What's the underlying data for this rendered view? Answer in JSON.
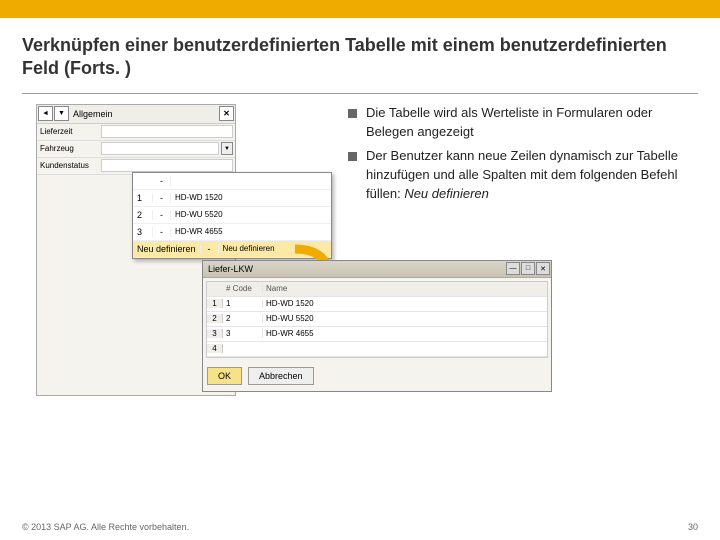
{
  "slide": {
    "title": "Verknüpfen einer benutzerdefinierten Tabelle mit einem benutzerdefinierten Feld (Forts. )",
    "footer_left": "© 2013 SAP AG. Alle Rechte vorbehalten.",
    "footer_right": "30"
  },
  "bullets": [
    "Die Tabelle wird als Werteliste in Formularen oder Belegen angezeigt",
    "Der Benutzer kann neue Zeilen dynamisch zur Tabelle hinzufügen und alle Spalten mit dem folgenden Befehl füllen: "
  ],
  "bullet2_italic": "Neu definieren",
  "shot1": {
    "header": "Allgemein",
    "row1": "Lieferzeit",
    "row2": "Fahrzeug",
    "row3": "Kundenstatus"
  },
  "dropdown": {
    "rows": [
      {
        "n": "",
        "mid": "-",
        "val": ""
      },
      {
        "n": "1",
        "mid": "-",
        "val": "HD-WD 1520"
      },
      {
        "n": "2",
        "mid": "-",
        "val": "HD-WU 5520"
      },
      {
        "n": "3",
        "mid": "-",
        "val": "HD-WR 4655"
      },
      {
        "n": "Neu definieren",
        "mid": "-",
        "val": "Neu definieren"
      }
    ]
  },
  "shot2": {
    "title": "Liefer-LKW",
    "header_code": "# Code",
    "header_name": "Name",
    "rows": [
      {
        "n": "1",
        "code": "1",
        "name": "HD-WD 1520"
      },
      {
        "n": "2",
        "code": "2",
        "name": "HD-WU 5520"
      },
      {
        "n": "3",
        "code": "3",
        "name": "HD-WR 4655"
      },
      {
        "n": "4",
        "code": "",
        "name": ""
      }
    ],
    "ok": "OK",
    "cancel": "Abbrechen"
  }
}
